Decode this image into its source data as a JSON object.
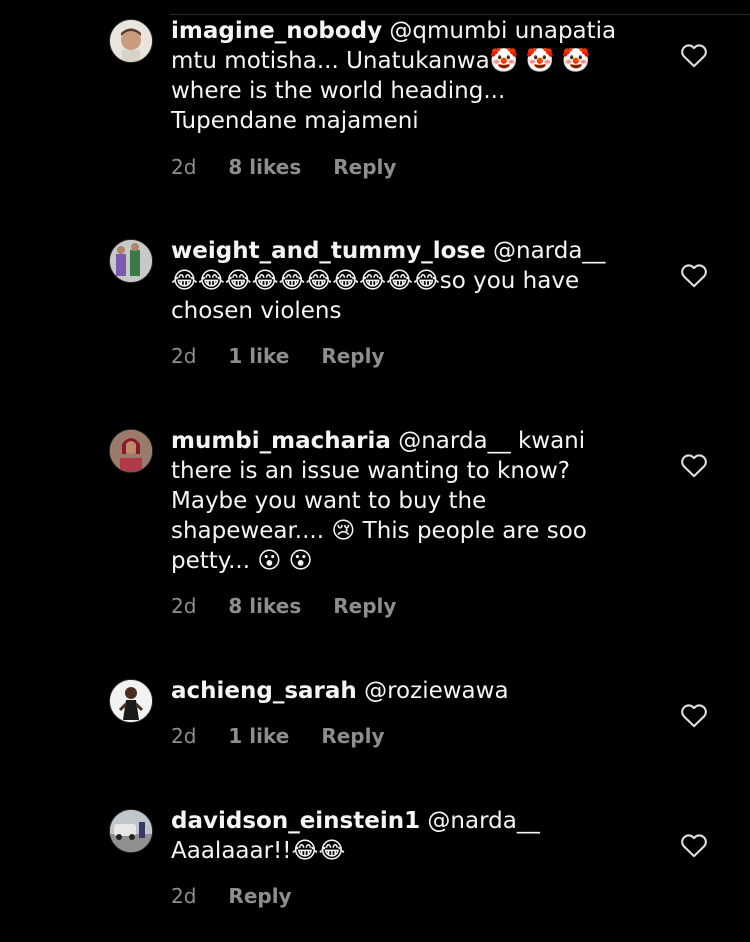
{
  "comments": [
    {
      "username": "imagine_nobody",
      "text": " @qmumbi unapatia mtu motisha... Unatukanwa🤡 🤡 🤡 where is the world heading... Tupendane majameni",
      "time": "2d",
      "likes": "8 likes",
      "reply": "Reply"
    },
    {
      "username": "weight_and_tummy_lose",
      "text": " @narda__ 😂😂😂😂😂😂😂😂😂😂so you have chosen violens",
      "time": "2d",
      "likes": "1 like",
      "reply": "Reply"
    },
    {
      "username": "mumbi_macharia",
      "text": " @narda__ kwani there is an issue wanting to know? Maybe you want to buy the shapewear.... 😢 This  people are soo petty... 😮 😮",
      "time": "2d",
      "likes": "8 likes",
      "reply": "Reply"
    },
    {
      "username": "achieng_sarah",
      "text": " @roziewawa",
      "time": "2d",
      "likes": "1 like",
      "reply": "Reply"
    },
    {
      "username": "davidson_einstein1",
      "text": " @narda__ Aaalaaar!!😂😂",
      "time": "2d",
      "likes": "",
      "reply": "Reply"
    }
  ],
  "icons": {
    "like": "heart-outline-icon",
    "avatar": "user-avatar"
  },
  "colors": {
    "background": "#000000",
    "text": "#f5f5f5",
    "secondary": "#8e8e8e"
  }
}
